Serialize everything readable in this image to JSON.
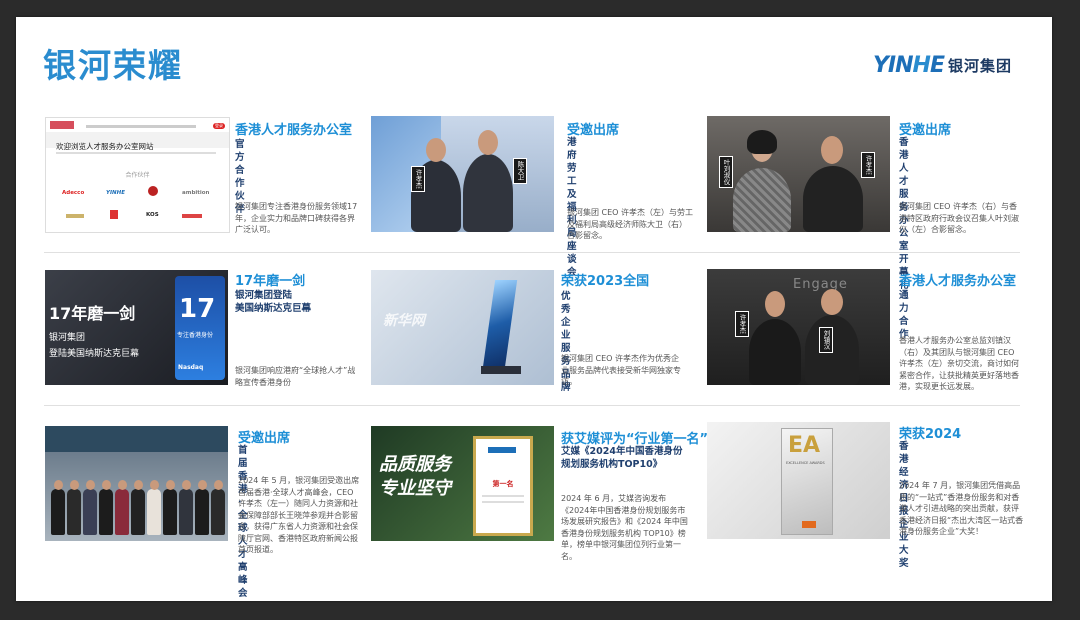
{
  "page_title": "银河荣耀",
  "logo": {
    "mark_a": "YIN",
    "mark_b": "H",
    "mark_c": "E",
    "cn": "银河集团"
  },
  "cards": [
    {
      "title": "香港人才服务办公室",
      "subtitle": "官方合作伙伴",
      "desc": "银河集团专注香港身份服务领域17年，企业实力和品牌口碑获得各界广泛认可。",
      "img": {
        "site_heading": "欢迎浏览人才服务办公室网站",
        "partners_label": "合作伙伴",
        "partners": [
          "Adecco",
          "YINHE",
          "",
          "ambition",
          "",
          "",
          "KOS",
          ""
        ],
        "nav_button": "登录"
      }
    },
    {
      "title": "受邀出席",
      "subtitle": "港府劳工及福利局座谈会",
      "desc": "银河集团 CEO 许孝杰（左）与劳工及福利局高级经济师陈大卫（右）合影留念。",
      "img": {
        "tag_left": "许孝杰",
        "tag_right": "陈大卫"
      }
    },
    {
      "title": "受邀出席",
      "subtitle": "香港人才服务办公室开幕礼",
      "desc": "银河集团 CEO 许孝杰（右）与香港特区政府行政会议召集人叶刘淑仪（左）合影留念。",
      "img": {
        "tag_left": "叶刘淑仪",
        "tag_right": "许孝杰"
      }
    },
    {
      "title": "17年磨一剑",
      "subtitle": "银河集团登陆\n美国纳斯达克巨幕",
      "desc": "银河集团响应港府“全球抢人才”战略宣传香港身份",
      "img": {
        "headline": "17年磨一剑",
        "line1": "银河集团",
        "line2": "登陆美国纳斯达克巨幕",
        "screen_big": "17",
        "screen_small": "专注香港身份",
        "nasdaq": "Nasdaq"
      }
    },
    {
      "title": "荣获2023全国",
      "subtitle": "优秀企业服务品牌",
      "desc": "银河集团 CEO 许孝杰作为优秀企业服务品牌代表接受新华网独家专访。",
      "img": {
        "watermark": "新华网"
      }
    },
    {
      "title": "香港人才服务办公室",
      "subtitle": "通力合作",
      "desc": "香港人才服务办公室总监刘镇汉（右）及其团队与银河集团 CEO 许孝杰（左）亲切交流，商讨如何紧密合作，让获批精英更好落地香港，实现更长远发展。",
      "img": {
        "tag_left": "许孝杰",
        "tag_right": "刘镇汉",
        "bg_word": "Engage"
      }
    },
    {
      "title": "受邀出席",
      "subtitle": "首届香港·全球人才高峰会",
      "desc": "2024 年 5 月，银河集团受邀出席首届香港·全球人才高峰会，CEO 许孝杰（左一）随同人力资源和社会保障部部长王晓萍参观并合影留念，获得广东省人力资源和社会保障厅官网、香港特区政府新闻公报首页报道。",
      "img": {}
    },
    {
      "title": "获艾媒评为“行业第一名”",
      "subtitle": "艾媒《2024年中国香港身份\n规划服务机构TOP10》",
      "desc": "2024 年 6 月，艾媒咨询发布《2024年中国香港身份规划服务市场发展研究报告》和《2024 年中国香港身份规划服务机构 TOP10》榜单，榜单中银河集团位列行业第一名。",
      "img": {
        "slogan1": "品质服务",
        "slogan2": "专业坚守",
        "cert_label": "第一名"
      }
    },
    {
      "title": "荣获2024",
      "subtitle": "香港经济日报企业大奖",
      "desc": "2024 年 7 月，银河集团凭借高品质的“一站式”香港身份服务和对香港人才引进战略的突出贡献，获评香港经济日报“杰出大湾区一站式香港身份服务企业”大奖！",
      "img": {
        "letters": "EA",
        "award_text": "EXCELLENCE AWARDS"
      }
    }
  ],
  "colors": {
    "accent": "#1e8fd6",
    "title": "#2a8ccf",
    "sub": "#1f3f6e"
  }
}
